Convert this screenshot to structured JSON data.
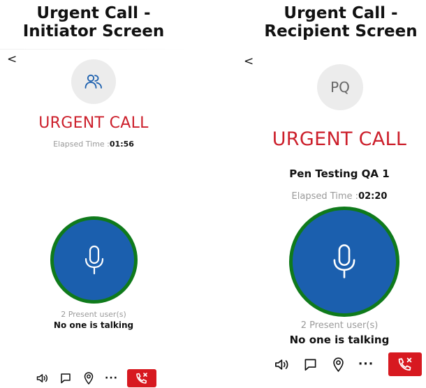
{
  "initiator": {
    "heading_line1": "Urgent Call -",
    "heading_line2": "Initiator Screen",
    "back_glyph": "<",
    "avatar_icon": "group-users-icon",
    "status_title": "URGENT CALL",
    "elapsed_label": "Elapsed Time :",
    "elapsed_value": "01:56",
    "present_users": "2 Present user(s)",
    "talking_status": "No one is talking"
  },
  "recipient": {
    "heading_line1": "Urgent Call -",
    "heading_line2": "Recipient Screen",
    "back_glyph": "<",
    "avatar_initials": "PQ",
    "status_title": "URGENT CALL",
    "caller_name": "Pen Testing QA 1",
    "elapsed_label": "Elapsed Time :",
    "elapsed_value": "02:20",
    "present_users": "2 Present user(s)",
    "talking_status": "No one is talking"
  },
  "toolbar": {
    "more_glyph": "···",
    "icons": [
      "speaker-icon",
      "chat-icon",
      "location-icon",
      "more-icon",
      "end-call-icon"
    ]
  },
  "colors": {
    "urgent_red": "#cc1f2b",
    "ptt_blue": "#1b5fae",
    "ptt_ring_green": "#0f7a1b",
    "end_call_red": "#d71920",
    "muted_gray": "#9a9a9a",
    "accent_blue": "#1b5fae"
  }
}
